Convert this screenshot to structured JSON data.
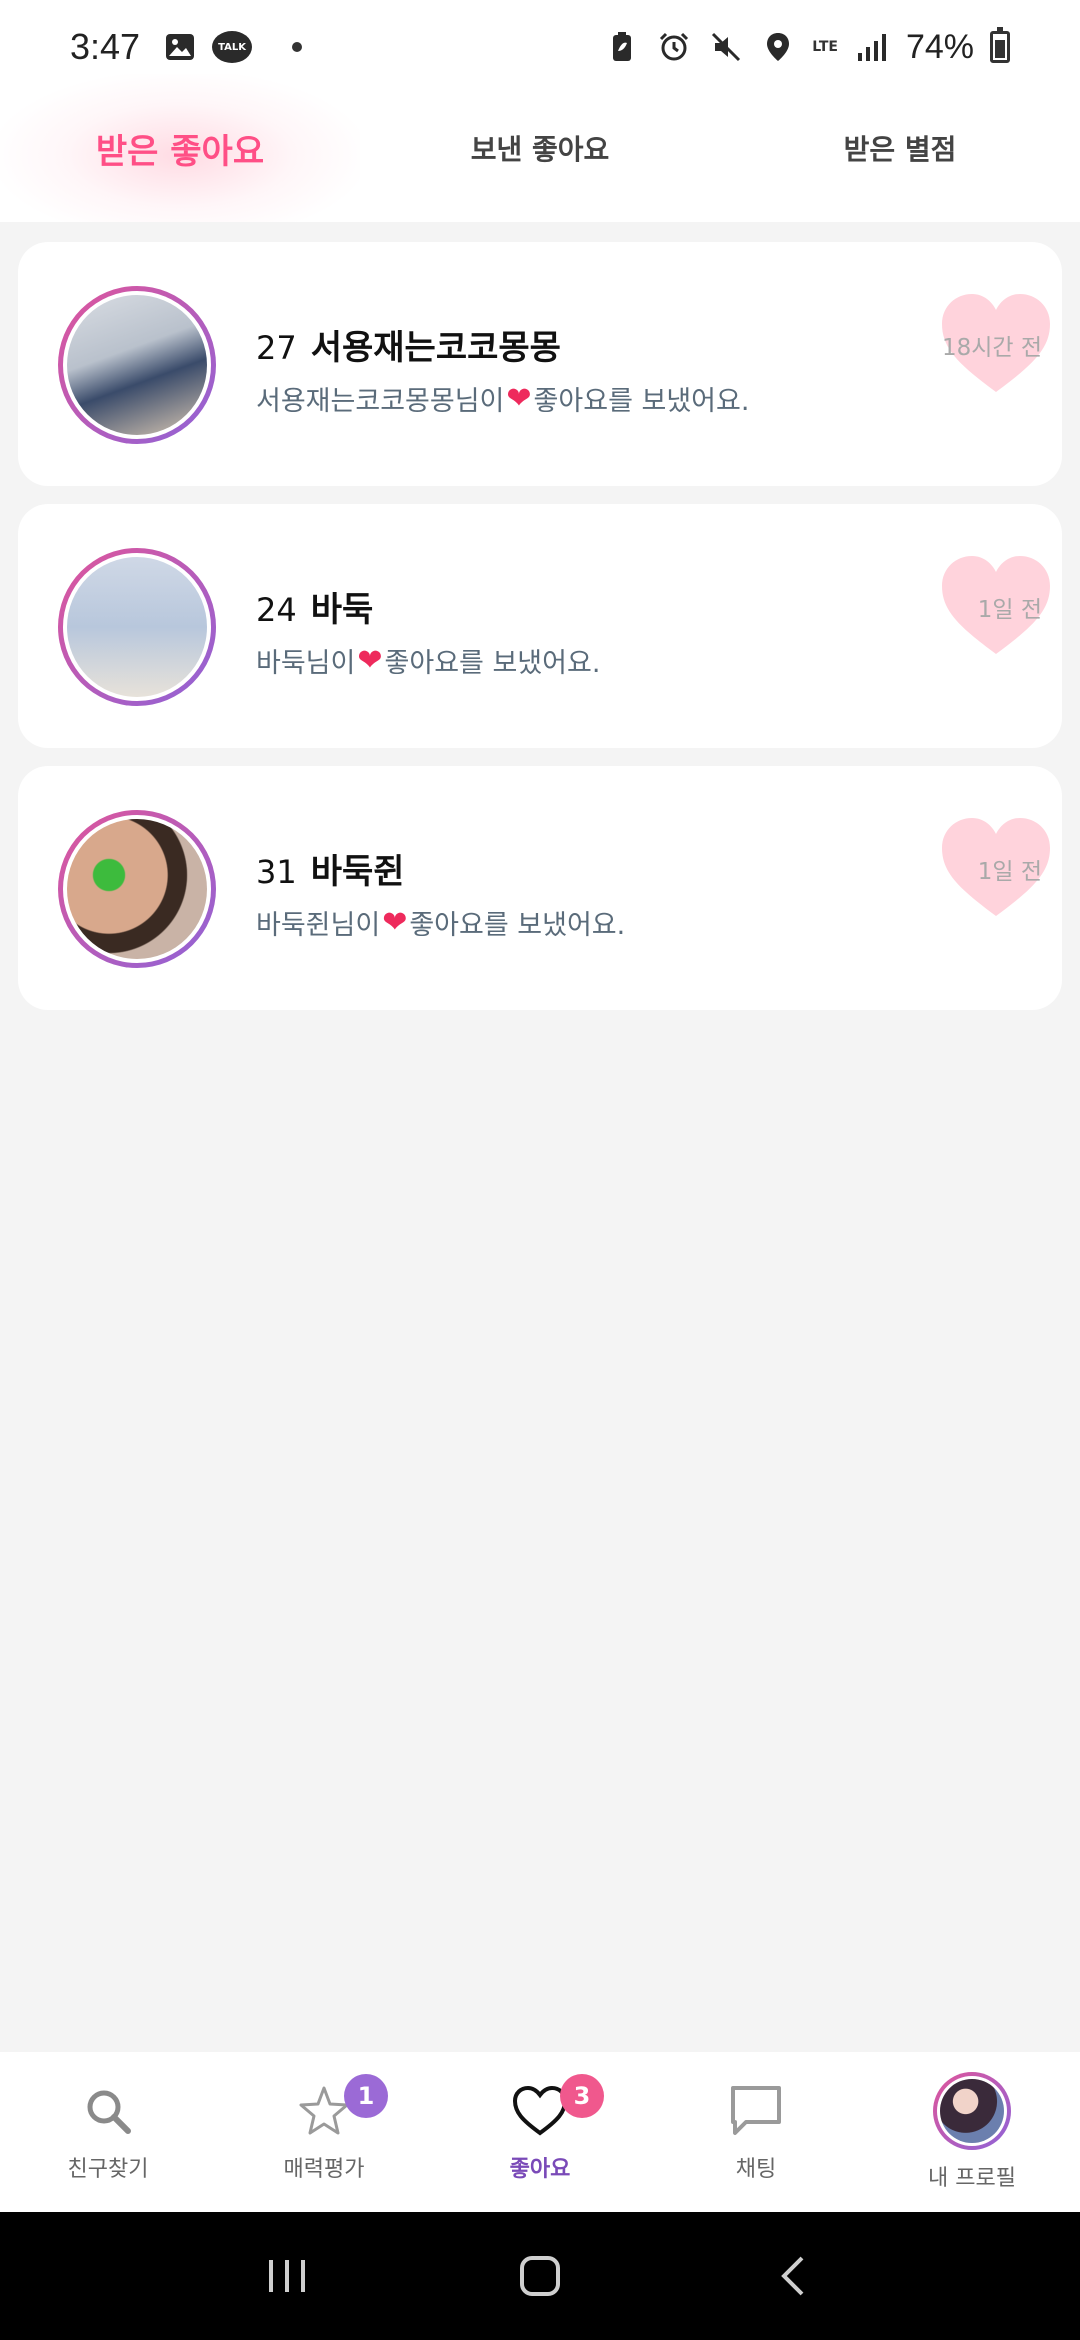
{
  "status_bar": {
    "time": "3:47",
    "talk_label": "TALK",
    "battery_percent": "74%",
    "network": "LTE"
  },
  "tabs": [
    {
      "label": "받은 좋아요",
      "active": true
    },
    {
      "label": "보낸 좋아요",
      "active": false
    },
    {
      "label": "받은 별점",
      "active": false
    }
  ],
  "likes": [
    {
      "age": "27",
      "name": "서용재는코코몽몽",
      "message_prefix": "서용재는코코몽몽님이 ",
      "message_suffix": "좋아요를 보냈어요.",
      "time": "18시간 전"
    },
    {
      "age": "24",
      "name": "바둑",
      "message_prefix": "바둑님이 ",
      "message_suffix": "좋아요를 보냈어요.",
      "time": "1일 전"
    },
    {
      "age": "31",
      "name": "바둑쥔",
      "message_prefix": "바둑쥔님이 ",
      "message_suffix": "좋아요를 보냈어요.",
      "time": "1일 전"
    }
  ],
  "bottom_nav": [
    {
      "label": "친구찾기",
      "icon": "search-icon"
    },
    {
      "label": "매력평가",
      "icon": "star-icon",
      "badge": "1"
    },
    {
      "label": "좋아요",
      "icon": "heart-icon",
      "badge": "3",
      "active": true
    },
    {
      "label": "채팅",
      "icon": "chat-icon"
    },
    {
      "label": "내 프로필",
      "icon": "profile-avatar"
    }
  ],
  "colors": {
    "accent_pink": "#ff4f86",
    "active_purple": "#7a4ab8",
    "heart_badge": "#ffd3dc"
  }
}
